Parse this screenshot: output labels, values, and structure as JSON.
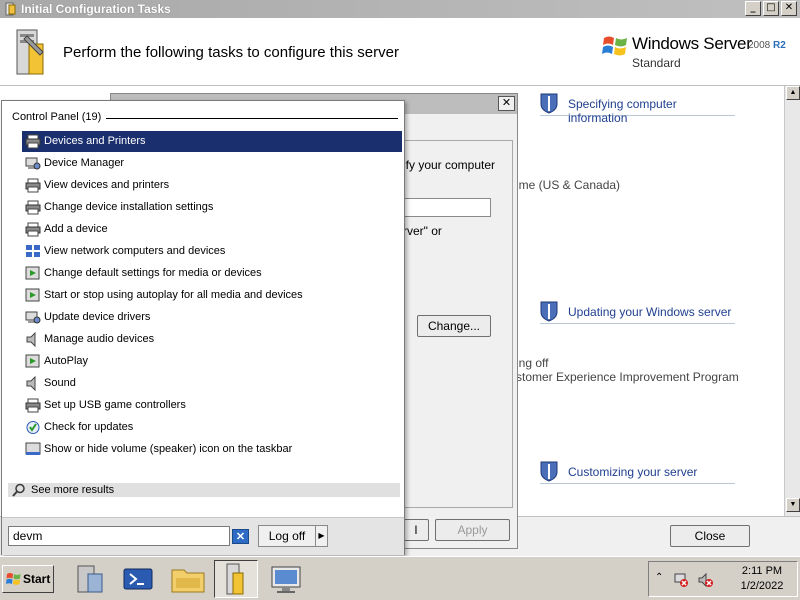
{
  "window": {
    "title": "Initial Configuration Tasks",
    "buttons": {
      "minimize": "_",
      "maximize": "□",
      "close": "✕"
    }
  },
  "header": {
    "title": "Perform the following tasks to configure this server",
    "logo_text": "Windows Server",
    "logo_version": "2008",
    "logo_r2": "R2",
    "logo_edition": "Standard"
  },
  "content": {
    "sections": [
      {
        "title": "Specifying computer information",
        "icon": "shield-icon"
      },
      {
        "title": "Updating your Windows server",
        "icon": "shield-icon"
      },
      {
        "title": "Customizing your server",
        "icon": "shield-icon"
      }
    ],
    "fragments": {
      "time_zone": "ime (US & Canada)",
      "updates_off": "ing off",
      "ceip": "stomer Experience Improvement Program"
    }
  },
  "dialog": {
    "partial_text_1": "ify your computer",
    "partial_text_2": "rver\" or",
    "change_button": "Change...",
    "cancel_partial": "l",
    "apply_button": "Apply",
    "close_button_x": "✕"
  },
  "footer": {
    "close_button": "Close"
  },
  "start_menu": {
    "group_label": "Control Panel (19)",
    "items": [
      {
        "label": "Devices and Printers",
        "icon": "printer-icon",
        "selected": true
      },
      {
        "label": "Device Manager",
        "icon": "device-manager-icon"
      },
      {
        "label": "View devices and printers",
        "icon": "printer-icon"
      },
      {
        "label": "Change device installation settings",
        "icon": "printer-icon"
      },
      {
        "label": "Add a device",
        "icon": "printer-icon"
      },
      {
        "label": "View network computers and devices",
        "icon": "network-icon"
      },
      {
        "label": "Change default settings for media or devices",
        "icon": "autoplay-icon"
      },
      {
        "label": "Start or stop using autoplay for all media and devices",
        "icon": "autoplay-icon"
      },
      {
        "label": "Update device drivers",
        "icon": "device-manager-icon"
      },
      {
        "label": "Manage audio devices",
        "icon": "speaker-icon"
      },
      {
        "label": "AutoPlay",
        "icon": "autoplay-icon"
      },
      {
        "label": "Sound",
        "icon": "speaker-icon"
      },
      {
        "label": "Set up USB game controllers",
        "icon": "printer-icon"
      },
      {
        "label": "Check for updates",
        "icon": "windows-update-icon"
      },
      {
        "label": "Show or hide volume (speaker) icon on the taskbar",
        "icon": "taskbar-icon"
      }
    ],
    "see_more": "See more results",
    "search_value": "devm",
    "clear_button": "✕",
    "log_off": "Log off",
    "log_off_arrow": "▶"
  },
  "taskbar": {
    "start_label": "Start",
    "pinned": [
      "server-manager-icon",
      "powershell-icon",
      "explorer-icon",
      "initial-config-icon",
      "remote-desktop-icon"
    ],
    "tray": {
      "time": "2:11 PM",
      "date": "1/2/2022"
    }
  },
  "colors": {
    "selection": "#1a2f6e",
    "link": "#1f3f8f",
    "search_clear": "#2d6bc4"
  }
}
